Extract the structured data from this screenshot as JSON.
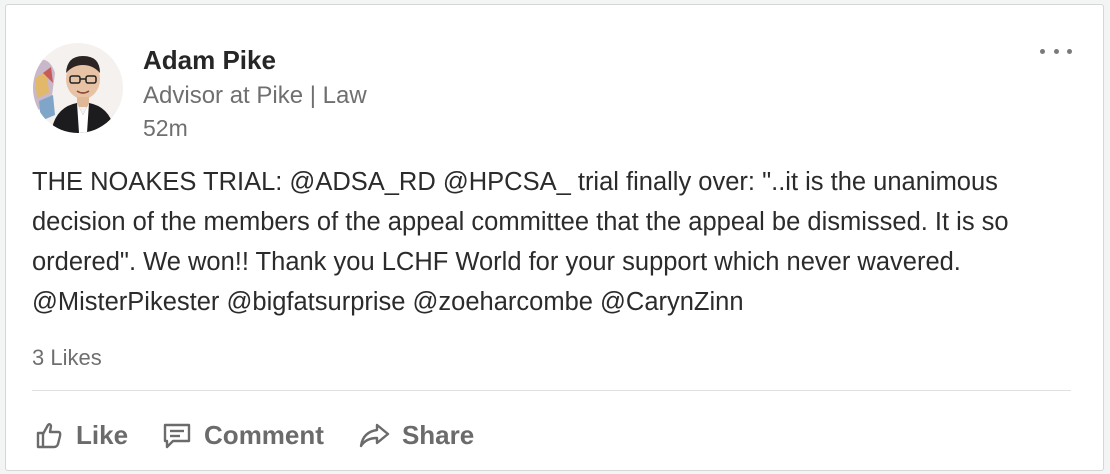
{
  "post": {
    "author": {
      "name": "Adam Pike",
      "headline": "Advisor at Pike | Law",
      "avatar_icon": "profile-photo"
    },
    "timestamp": "52m",
    "more_icon": "ellipsis-icon",
    "text": "THE NOAKES TRIAL: @ADSA_RD @HPCSA_ trial finally over: \"..it is the unanimous decision of the members of the appeal committee that the appeal be dismissed. It is so ordered\". We won!! Thank you LCHF World for your support which never wavered. @MisterPikester @bigfatsurprise @zoeharcombe @CarynZinn",
    "likes": "3 Likes"
  },
  "actions": {
    "like": {
      "label": "Like",
      "icon": "thumbs-up-icon"
    },
    "comment": {
      "label": "Comment",
      "icon": "comment-icon"
    },
    "share": {
      "label": "Share",
      "icon": "share-arrow-icon"
    }
  },
  "colors": {
    "text_primary": "#262626",
    "text_secondary": "#6f6f6f",
    "action_gray": "#6b6b6b",
    "card_border": "#d4d6d8"
  }
}
